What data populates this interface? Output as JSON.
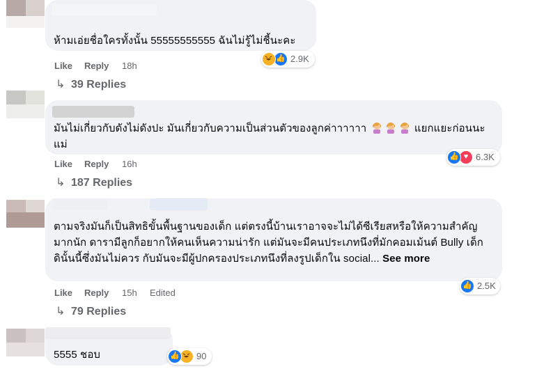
{
  "comments": [
    {
      "text": "ห้ามเอ่ยชื่อใครทั้งนั้น 55555555555 ฉันไม่รู้ไม่ชี้นะคะ",
      "actions": {
        "like": "Like",
        "reply": "Reply",
        "time": "18h"
      },
      "reactions": {
        "icons": [
          "haha-icon",
          "like-icon"
        ],
        "count": "2.9K"
      },
      "replies": "39 Replies"
    },
    {
      "text_before": "มันไม่เกี่ยวกับดังไม่ดังปะ มันเกี่ยวกับความเป็นส่วนตัวของลูกค่าาาาาา",
      "text_after": "แยกแยะก่อนนะแม่",
      "emoji": "facepalm-emoji",
      "actions": {
        "like": "Like",
        "reply": "Reply",
        "time": "16h"
      },
      "reactions": {
        "icons": [
          "like-icon",
          "love-icon"
        ],
        "count": "6.3K"
      },
      "replies": "187 Replies"
    },
    {
      "text": "ตามจริงมันก็เป็นสิทธิขั้นพื้นฐานของเด็ก แต่ตรงนี้บ้านเราอาจจะไม่ได้ซีเรียสหรือให้ความสำคัญมากนัก ดารามีลูกก็อยากให้คนเห็นความน่ารัก แต่มันจะมีคนประเภทนึงที่มักคอมเม้นต์ Bully เด็ก ดินั้นนี้ซึ่งมันไม่ควร กับมันจะมีผู้ปกครองประเภทนึงที่ลงรูปเด็กใน social...",
      "see_more": "See more",
      "actions": {
        "like": "Like",
        "reply": "Reply",
        "time": "15h",
        "edited": "Edited"
      },
      "reactions": {
        "icons": [
          "like-icon"
        ],
        "count": "2.5K"
      },
      "replies": "79 Replies"
    },
    {
      "text": "5555 ชอบ",
      "reactions": {
        "icons": [
          "like-icon",
          "haha-icon"
        ],
        "count": "90"
      }
    }
  ],
  "colors": {
    "bubble": "#f0f2f5",
    "meta_text": "#65676b",
    "like": "#1877f2",
    "love": "#f33e58",
    "haha": "#f7b125"
  }
}
